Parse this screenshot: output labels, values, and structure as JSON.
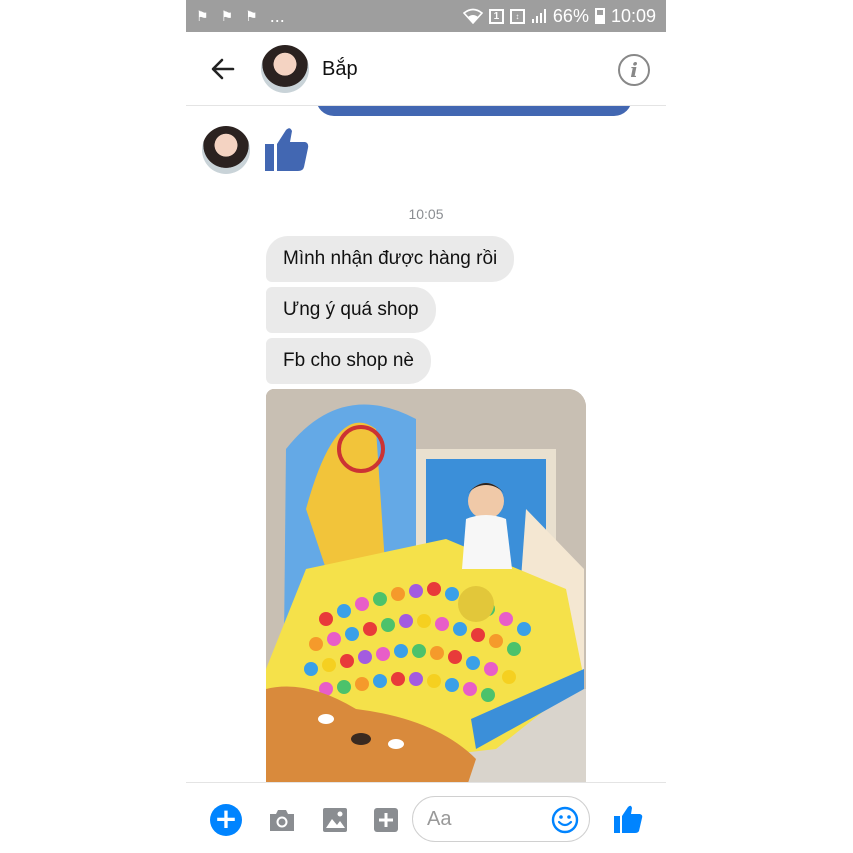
{
  "status_bar": {
    "notification_icons": [
      "flag-icon",
      "flag-icon",
      "flag-icon"
    ],
    "more": "...",
    "sim_badge": "1",
    "battery": "66%",
    "time": "10:09"
  },
  "header": {
    "contact_name": "Bắp"
  },
  "conversation": {
    "timestamp": "10:05",
    "messages": [
      "Mình nhận được hàng rồi",
      "Ưng ý quá shop",
      "Fb cho shop nè"
    ],
    "photo_description": "baby sitting in a ball-pit play tent"
  },
  "composer": {
    "placeholder": "Aa",
    "icons": [
      "plus-icon",
      "camera-icon",
      "image-icon",
      "sticker-icon",
      "emoji-icon",
      "thumbs-up-icon"
    ]
  },
  "colors": {
    "messenger_blue": "#0084ff",
    "like_blue": "#4267b2",
    "bubble_gray": "#eaeaea",
    "status_bar_gray": "#9e9e9e"
  }
}
